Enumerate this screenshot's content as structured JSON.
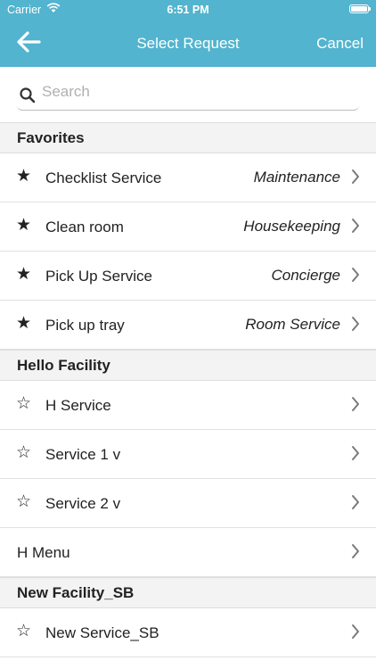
{
  "status": {
    "carrier": "Carrier",
    "time": "6:51 PM"
  },
  "nav": {
    "title": "Select Request",
    "cancel": "Cancel",
    "back_icon": "arrow-left-icon"
  },
  "search": {
    "placeholder": "Search",
    "value": ""
  },
  "sections": [
    {
      "title": "Favorites",
      "items": [
        {
          "label": "Checklist Service",
          "category": "Maintenance",
          "favorite": true
        },
        {
          "label": "Clean room",
          "category": "Housekeeping",
          "favorite": true
        },
        {
          "label": "Pick Up Service",
          "category": "Concierge",
          "favorite": true
        },
        {
          "label": "Pick up tray",
          "category": "Room Service",
          "favorite": true
        }
      ]
    },
    {
      "title": "Hello Facility",
      "items": [
        {
          "label": "H Service",
          "category": "",
          "favorite": false
        },
        {
          "label": "Service 1 v",
          "category": "",
          "favorite": false
        },
        {
          "label": "Service 2 v",
          "category": "",
          "favorite": false
        },
        {
          "label": "H Menu",
          "category": "",
          "favorite": null
        }
      ]
    },
    {
      "title": "New Facility_SB",
      "items": [
        {
          "label": "New Service_SB",
          "category": "",
          "favorite": false
        }
      ]
    }
  ],
  "glyphs": {
    "star_filled": "★",
    "star_empty": "☆"
  },
  "colors": {
    "header": "#52b4ce",
    "section_bg": "#f3f3f3"
  }
}
